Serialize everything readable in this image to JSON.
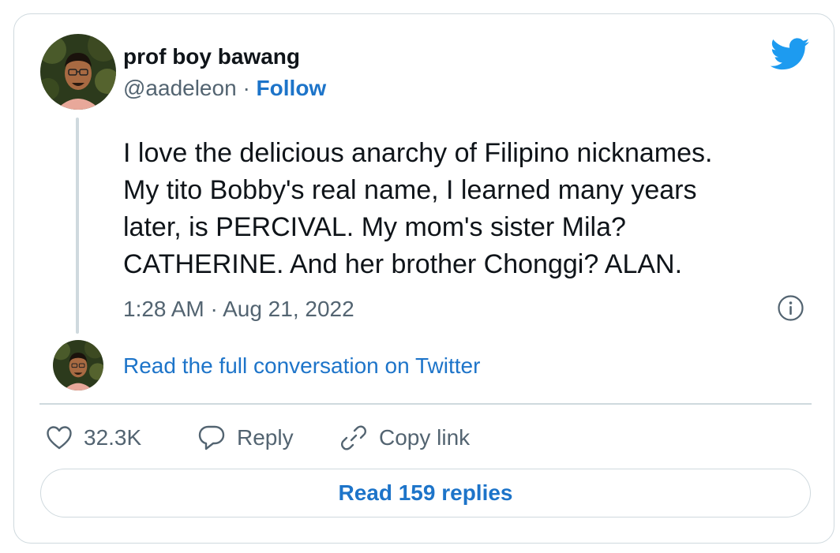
{
  "author": {
    "name": "prof boy bawang",
    "handle": "@aadeleon",
    "separator": "·",
    "follow_label": "Follow"
  },
  "tweet": {
    "lines": [
      "I love the delicious anarchy of Filipino nicknames.",
      "My tito Bobby's real name, I learned many years",
      "later, is PERCIVAL. My mom's sister Mila?",
      "CATHERINE. And her brother Chonggi? ALAN."
    ],
    "timestamp": "1:28 AM · Aug 21, 2022"
  },
  "conversation_link": "Read the full conversation on Twitter",
  "actions": {
    "likes_count": "32.3K",
    "reply_label": "Reply",
    "copy_link_label": "Copy link"
  },
  "read_replies_label": "Read 159 replies",
  "icons": {
    "brand": "twitter-bird-icon",
    "info": "info-icon",
    "like": "heart-icon",
    "reply": "reply-bubble-icon",
    "copy": "link-icon"
  },
  "colors": {
    "twitter_blue": "#1d9bf0",
    "link_blue": "#1d74c9",
    "secondary_text": "#536471",
    "border": "#cfd9de"
  }
}
